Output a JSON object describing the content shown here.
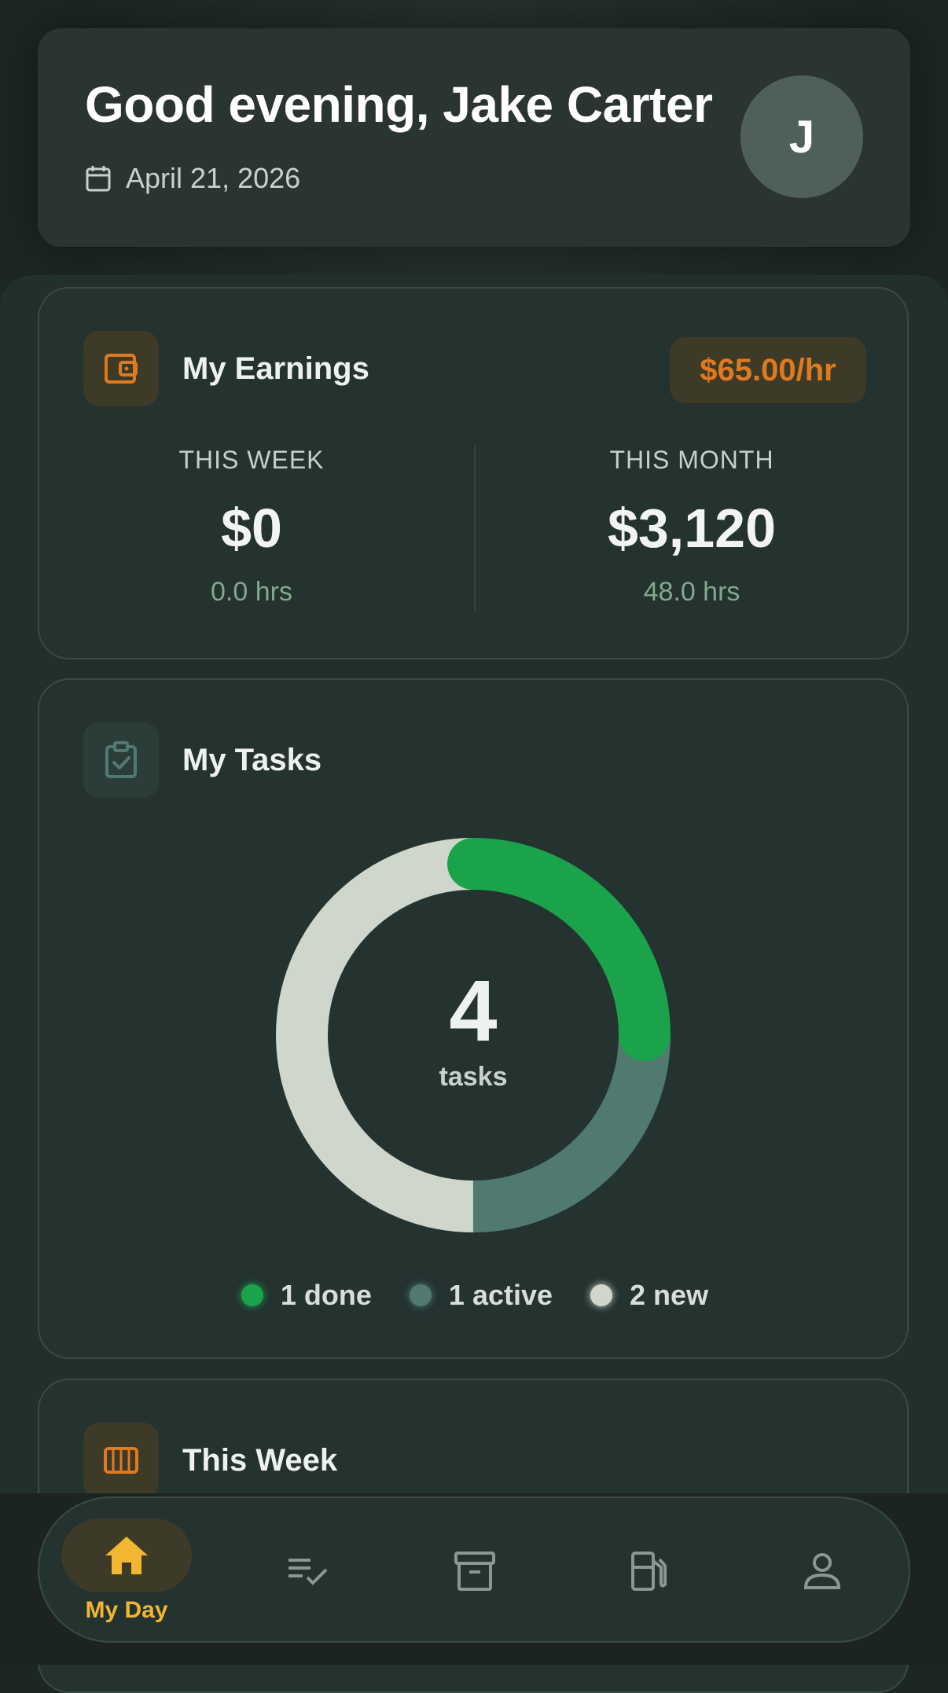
{
  "header": {
    "greeting": "Good evening, Jake Carter",
    "date": "April 21, 2026",
    "avatar_initial": "J"
  },
  "earnings": {
    "title": "My Earnings",
    "rate": "$65.00/hr",
    "this_week": {
      "label": "THIS WEEK",
      "value": "$0",
      "hours": "0.0 hrs"
    },
    "this_month": {
      "label": "THIS MONTH",
      "value": "$3,120",
      "hours": "48.0 hrs"
    }
  },
  "tasks": {
    "title": "My Tasks",
    "total": "4",
    "total_label": "tasks",
    "legend": [
      {
        "label": "1 done",
        "color": "#1aa34a"
      },
      {
        "label": "1 active",
        "color": "#507a70"
      },
      {
        "label": "2 new",
        "color": "#cfd6cb"
      }
    ]
  },
  "chart_data": {
    "type": "pie",
    "categories": [
      "done",
      "active",
      "new"
    ],
    "values": [
      1,
      1,
      2
    ],
    "colors": [
      "#1aa34a",
      "#507a70",
      "#cfd6cb"
    ]
  },
  "week": {
    "title": "This Week"
  },
  "nav": {
    "items": [
      {
        "label": "My Day",
        "icon": "home-icon",
        "active": true
      },
      {
        "label": "",
        "icon": "task-list-icon",
        "active": false
      },
      {
        "label": "",
        "icon": "archive-icon",
        "active": false
      },
      {
        "label": "",
        "icon": "fuel-icon",
        "active": false
      },
      {
        "label": "",
        "icon": "profile-icon",
        "active": false
      }
    ]
  },
  "colors": {
    "accent_orange": "#e07a1f",
    "accent_yellow": "#f2b630",
    "card_bg": "#243230"
  }
}
